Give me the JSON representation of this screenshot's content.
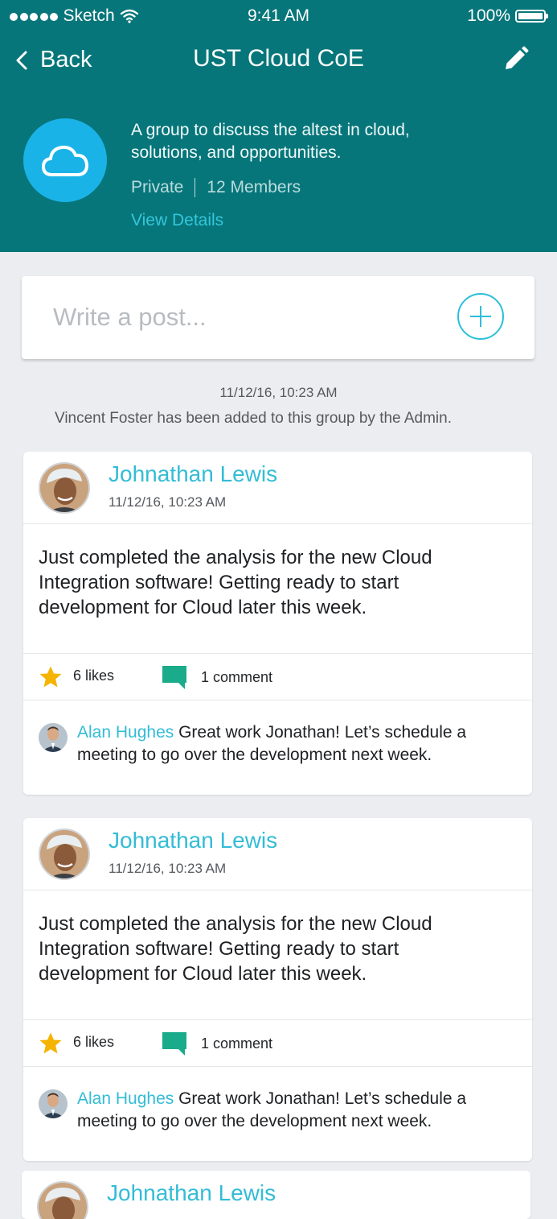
{
  "status_bar": {
    "carrier": "Sketch",
    "time": "9:41 AM",
    "battery": "100%"
  },
  "nav": {
    "back_label": "Back",
    "title": "UST Cloud CoE"
  },
  "group": {
    "description": "A group to discuss the altest in cloud, solutions, and opportunities.",
    "privacy": "Private",
    "members": "12 Members",
    "view_details": "View Details"
  },
  "composer": {
    "placeholder": "Write a post..."
  },
  "system_message": {
    "time": "11/12/16, 10:23 AM",
    "text": "Vincent Foster has been added to this group by the Admin."
  },
  "posts": [
    {
      "author": "Johnathan Lewis",
      "time": "11/12/16, 10:23 AM",
      "body": "Just completed the analysis for the new Cloud Integration software! Getting ready to start development for Cloud later this week.",
      "likes": "6 likes",
      "comments": "1 comment",
      "comment": {
        "author": "Alan Hughes",
        "text": " Great work Jonathan! Let’s schedule a meeting to go over the development next week."
      }
    },
    {
      "author": "Johnathan Lewis",
      "time": "11/12/16, 10:23 AM",
      "body": "Just completed the analysis for the new Cloud Integration software! Getting ready to start development for Cloud later this week.",
      "likes": "6 likes",
      "comments": "1 comment",
      "comment": {
        "author": "Alan Hughes",
        "text": " Great work Jonathan! Let’s schedule a meeting to go over the development next week."
      }
    },
    {
      "author": "Johnathan Lewis"
    }
  ],
  "colors": {
    "header": "#07767a",
    "accent": "#33bcd6",
    "star": "#f5b400",
    "comment_icon": "#1aab8a"
  }
}
